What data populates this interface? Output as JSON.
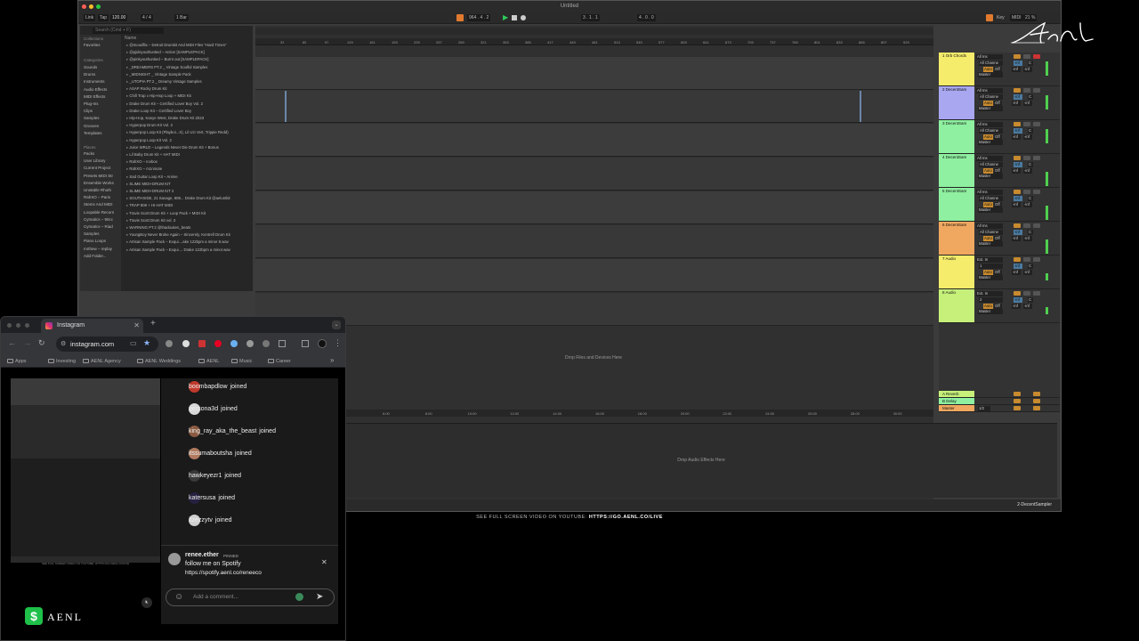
{
  "ableton": {
    "title": "Untitled",
    "controls": {
      "link": "Link",
      "tap": "Tap",
      "tempo": "120.00",
      "meter": "4 / 4",
      "quant": "1 Bar",
      "pos": "964 . 4 . 2",
      "pos2": "3 . 1 . 1",
      "loop_len": "4 . 0 . 0",
      "key": "Key",
      "midi": "MIDI",
      "cpu": "21 %"
    },
    "browser": {
      "search_placeholder": "Search (Cmd + F)",
      "collections_label": "Collections",
      "favorites": "Favorites",
      "categories_label": "Categories",
      "categories": [
        "Sounds",
        "Drums",
        "Instruments",
        "Audio Effects",
        "MIDI Effects",
        "Plug-Ins",
        "Clips",
        "Samples",
        "Grooves",
        "Templates"
      ],
      "places_label": "Places",
      "places": [
        "Packs",
        "User Library",
        "Current Project",
        "Presets MIDI Str",
        "Ensemble Works",
        "Unstable Rhoth",
        "RahXO – Paris",
        "Stems And MIDI",
        "Loopable Recorn",
        "Cymatics – 90cc",
        "Cymatics – Riad",
        "Samples",
        "Piano Loops",
        "mrthew – replay",
        "Add Folder..."
      ],
      "name_header": "Name",
      "files": [
        "@moodflix – Detroit Drumkit And MIDI Files \"Hard Times\"",
        "@pjidsyouthuntied – Action [SAMPLEPACK]",
        "@pinkyouthuntied – Burnt out [SAMPLEPACK]",
        "_DREAMERS PT.2 _ Vintage Soulful Samples",
        "_MIDNIGHT _ Vintage Sample Pack",
        "_UTOPIA PT.2 _ Dreamy Vintage Samples",
        "ASAP Rocky Drum Kit",
        "Chill Trap x Hip-Hop Loop + MIDI Kit",
        "Drake Drum Kit – Certified Lover Boy Vol. 2",
        "Drake Loop Kit – Certified Lover Boy",
        "Hip-Hop, Kanye West, Drake Drum Kit 2023",
        "Hyperpop Drum Kit Vol. 3",
        "Hyperpop Loop Kit (Playboi...X), Lil Uzi Vert, Trippie Redd)",
        "Hyperpop Loop Kit Vol. 2",
        "Juice WRLD – Legends Never Die Drum Kit + Bonus",
        "Lil Baby Drum Kit + HAT MIDI",
        "RahXO – Icebox",
        "RahXO – m1nmote",
        "Sad Guitar Loop Kit – Anime",
        "SLIME MIDI+DRUM KIT",
        "SLIME MIDI+DRUM KIT 2",
        "SOUTHSIDE, 21 Savage, 808... Drake Drum Kit @aeluntkit",
        "TRAP 808 + HI-HAT MIDI",
        "Travis Scott Drum Kit + Loop Pack + MIDI Kit",
        "Travis Scott Drum Kit vol. 3",
        "WARNING PT.2 @thadouken_beats",
        "YoungBoy Never Broke Again – Sincerely, Kentrell Drum Kit",
        "Artisan Sample Pack – Exqui....ake 122bpm a minor 8.wav",
        "Artisan Sample Pack – Exqui.... Drake 122bpm a minor.wav"
      ]
    },
    "ruler_ticks": [
      "33",
      "65",
      "97",
      "129",
      "161",
      "193",
      "225",
      "257",
      "289",
      "321",
      "353",
      "385",
      "417",
      "449",
      "481",
      "513",
      "545",
      "577",
      "609",
      "641",
      "673",
      "705",
      "737",
      "769",
      "801",
      "833",
      "865",
      "897",
      "929"
    ],
    "time_ticks": [
      "6:00",
      "8:00",
      "10:00",
      "12:00",
      "14:00",
      "16:00",
      "18:00",
      "20:00",
      "22:00",
      "24:00",
      "26:00",
      "28:00",
      "30:00"
    ],
    "tracks": [
      {
        "name": "1 Orb Chords",
        "color": "#f4ec6a",
        "input": "All Ins",
        "chan": "All Channe",
        "out": "Master"
      },
      {
        "name": "2 DecentSam",
        "color": "#a8a7f0",
        "input": "All Ins",
        "chan": "All Channe",
        "out": "Master"
      },
      {
        "name": "3 DecentSam",
        "color": "#8ef0a0",
        "input": "All Ins",
        "chan": "All Channe",
        "out": "Master"
      },
      {
        "name": "4 DecentSam",
        "color": "#8ef0a0",
        "input": "All Ins",
        "chan": "All Channe",
        "out": "Master"
      },
      {
        "name": "5 DecentSam",
        "color": "#8ef0a0",
        "input": "All Ins",
        "chan": "All Channe",
        "out": "Master"
      },
      {
        "name": "6 DecentSam",
        "color": "#f0a860",
        "input": "All Ins",
        "chan": "All Channe",
        "out": "Master"
      },
      {
        "name": "7 Audio",
        "color": "#f4ec6a",
        "input": "Ext. In",
        "chan": "1",
        "out": "Master"
      },
      {
        "name": "8 Audio",
        "color": "#c6f07a",
        "input": "Ext. In",
        "chan": "2",
        "out": "Master"
      }
    ],
    "returns": [
      {
        "name": "A Reverb",
        "color": "#c6f07a"
      },
      {
        "name": "B Delay",
        "color": "#8ef0a0"
      },
      {
        "name": "Master",
        "color": "#f0a860"
      }
    ],
    "mixer_labels": {
      "auto": "Auto",
      "off": "Off",
      "inf": "-inf",
      "c": "C",
      "master_split": "1/2"
    },
    "drop_files": "Drop Files and Devices Here",
    "drop_fx": "Drop Audio Effects Here",
    "selected_track": "2-DecentSampler"
  },
  "chrome": {
    "tab_title": "Instagram",
    "url": "instagram.com",
    "bookmarks": [
      "Apps",
      "Investing",
      "AENL Agency",
      "AENL Weddings",
      "AENL",
      "Music",
      "Career"
    ],
    "comments": [
      {
        "user": "boombapdlow",
        "text": "joined",
        "color": "#c0392b"
      },
      {
        "user": "persona3d",
        "text": "joined",
        "color": "#d8d8d8"
      },
      {
        "user": "king_ray_aka_the_beast",
        "text": "joined",
        "color": "#8a5a40"
      },
      {
        "user": "itssumaboutsha",
        "text": "joined",
        "color": "#b07a60"
      },
      {
        "user": "hawkeyezr1",
        "text": "joined",
        "color": "#3a3a3a"
      },
      {
        "user": "katersusa",
        "text": "joined",
        "color": "#262040"
      },
      {
        "user": "itzezzytv",
        "text": "joined",
        "color": "#cfcfcf"
      }
    ],
    "pinned": {
      "user": "renee.ether",
      "badge": "PINNED",
      "line1": "follow me on Spotify",
      "line2": "https://spotify.aenl.co/reneeco"
    },
    "comment_placeholder": "Add a comment..."
  },
  "overlay": {
    "youtube_prefix": "SEE FULL SCREEN VIDEO ON YOUTUBE: ",
    "youtube_url": "HTTPS://GO.AENL.CO/LIVE",
    "mini_caption": "SEE FULL SCREEN VIDEO ON YOUTUBE: HTTPS://GO.AENL.CO/LIVE",
    "brand_symbol": "$",
    "brand": "AENL",
    "signature": "Aenl"
  }
}
